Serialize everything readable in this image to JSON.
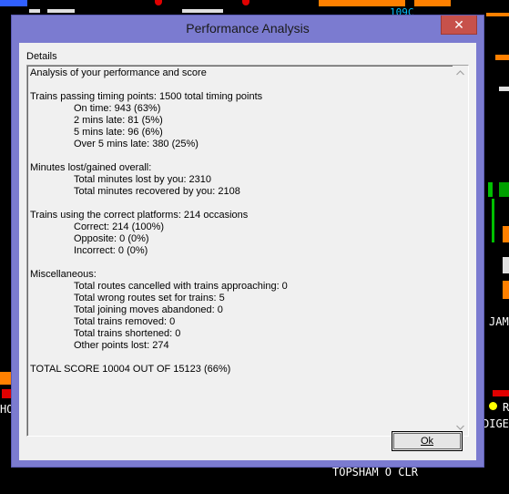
{
  "window": {
    "title": "Performance Analysis",
    "close_glyph": "✕"
  },
  "group_label": "Details",
  "report": {
    "heading": "Analysis of your performance and score",
    "timing": {
      "header": "Trains passing timing points: 1500 total timing points",
      "lines": [
        "On time: 943 (63%)",
        "2 mins late: 81 (5%)",
        "5 mins late: 96 (6%)",
        "Over 5 mins late: 380 (25%)"
      ]
    },
    "minutes": {
      "header": "Minutes lost/gained overall:",
      "lines": [
        "Total minutes lost by you: 2310",
        "Total minutes recovered by you: 2108"
      ]
    },
    "platforms": {
      "header": "Trains using the correct platforms: 214 occasions",
      "lines": [
        "Correct: 214 (100%)",
        "Opposite: 0 (0%)",
        "Incorrect: 0 (0%)"
      ]
    },
    "misc": {
      "header": "Miscellaneous:",
      "lines": [
        "Total routes cancelled with trains approaching: 0",
        "Total wrong routes set for trains: 5",
        "Total joining moves abandoned: 0",
        "Total trains removed: 0",
        "Total trains shortened: 0",
        "Other points lost: 274"
      ]
    },
    "total": "TOTAL SCORE 10004 OUT OF 15123 (66%)"
  },
  "buttons": {
    "ok_label": "Ok"
  },
  "background": {
    "label_top": "109C",
    "label_right_1": "JAM",
    "label_right_2": "DIGE",
    "label_left": "HO",
    "label_bottom": "TOPSHAM   O CLR",
    "label_right_ray": "R"
  },
  "colors": {
    "window_frame": "#7b7bd0",
    "close_button": "#c7514b",
    "client": "#f0f0f0",
    "signal_orange": "#ff8000",
    "signal_green": "#00c000",
    "signal_red": "#e00000",
    "signal_yellow": "#ffff00"
  },
  "icons": {
    "scroll_up": "scroll-up-arrow-icon",
    "scroll_down": "scroll-down-arrow-icon",
    "close": "close-icon"
  }
}
